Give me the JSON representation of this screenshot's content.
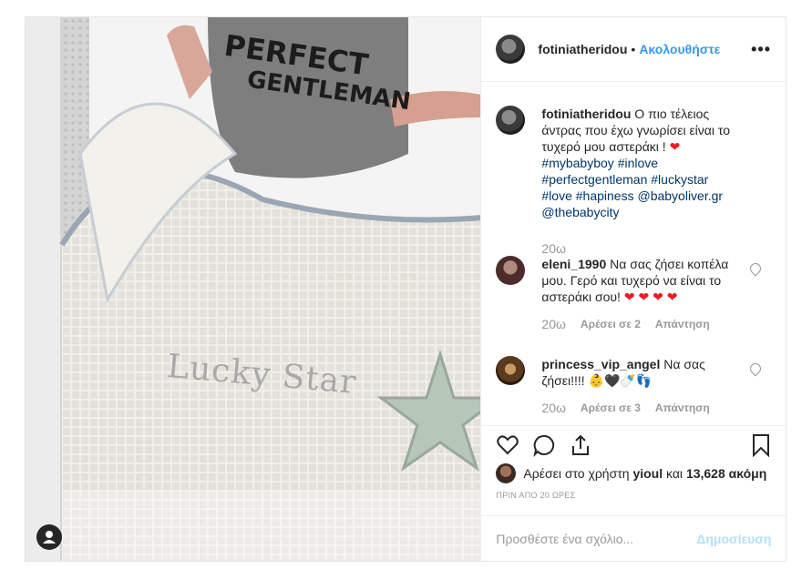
{
  "post": {
    "author": "fotiniatheridou",
    "separator": "•",
    "follow_label": "Ακολουθήστε",
    "more_label": "•••"
  },
  "photo": {
    "text_lines": [
      "PERFECT",
      "GENTLEMAN"
    ],
    "blanket_text": "Lucky Star"
  },
  "caption": {
    "author": "fotiniatheridou",
    "text": "Ο πιο τέλειος άντρας που έχω γνωρίσει είναι το τυχερό μου αστεράκι !",
    "heart": "❤",
    "hashtags_1": "#mybabyboy",
    "hashtags_2": "#inlove #perfectgentleman #luckystar",
    "hashtags_3": "#love #hapiness @babyoliver.gr",
    "hashtags_4": "@thebabycity",
    "time": "20ω"
  },
  "comments": [
    {
      "author": "eleni_1990",
      "text": "Να σας ζήσει κοπέλα μου. Γερό και τυχερό να είναι το αστεράκι σου!",
      "emoji": "❤ ❤ ❤ ❤",
      "time": "20ω",
      "likes": "Αρέσει σε 2",
      "reply": "Απάντηση"
    },
    {
      "author": "princess_vip_angel",
      "text": "Να σας ζήσει!!!!",
      "emoji": "👶🖤🍼👣",
      "time": "20ω",
      "likes": "Αρέσει σε 3",
      "reply": "Απάντηση"
    }
  ],
  "likes": {
    "prefix": "Αρέσει στο χρήστη",
    "user": "yioul",
    "middle": "και",
    "count": "13,628 ακόμη"
  },
  "timestamp": "ΠΡΙΝ ΑΠΟ 20 ΩΡΕΣ",
  "add_comment": {
    "placeholder": "Προσθέστε ένα σχόλιο...",
    "post_label": "Δημοσίευση"
  }
}
